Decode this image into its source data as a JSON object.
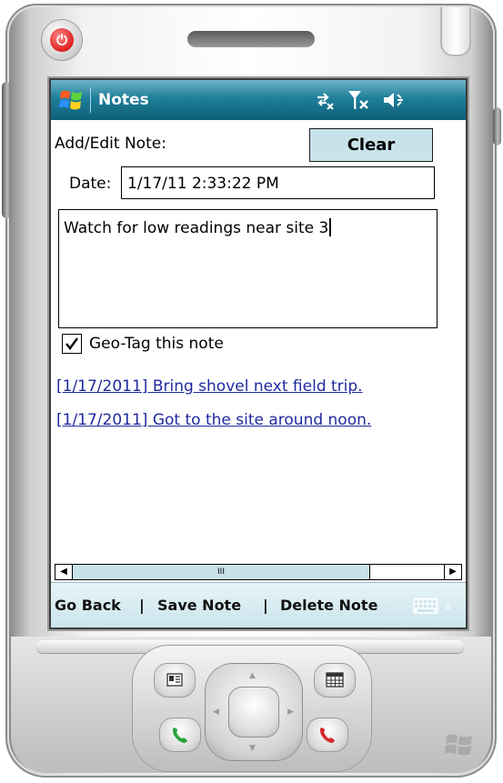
{
  "titlebar": {
    "app_title": "Notes",
    "icons": [
      "windows-start-flag-icon",
      "connectivity-icon",
      "signal-off-icon",
      "volume-icon"
    ]
  },
  "form": {
    "heading": "Add/Edit Note:",
    "clear_label": "Clear",
    "date_label": "Date:",
    "date_value": "1/17/11 2:33:22 PM",
    "note_text": "Watch for low readings near site 3",
    "geotag_label": "Geo-Tag this note",
    "geotag_checked": true
  },
  "notes": [
    {
      "text": "[1/17/2011] Bring shovel next field trip."
    },
    {
      "text": "[1/17/2011] Got to the site around noon."
    }
  ],
  "scrollbar": {
    "thumb_glyph": "III",
    "left_arrow": "◀",
    "right_arrow": "▶"
  },
  "menubar": {
    "items": [
      {
        "label": "Go Back"
      },
      {
        "label": "Save Note"
      },
      {
        "label": "Delete Note"
      }
    ],
    "separator": "|"
  },
  "colors": {
    "titlebar": "#1f7f9a",
    "button_fill": "#c8e2ea",
    "link": "#1f2a9e",
    "power_red": "#dd2020"
  }
}
